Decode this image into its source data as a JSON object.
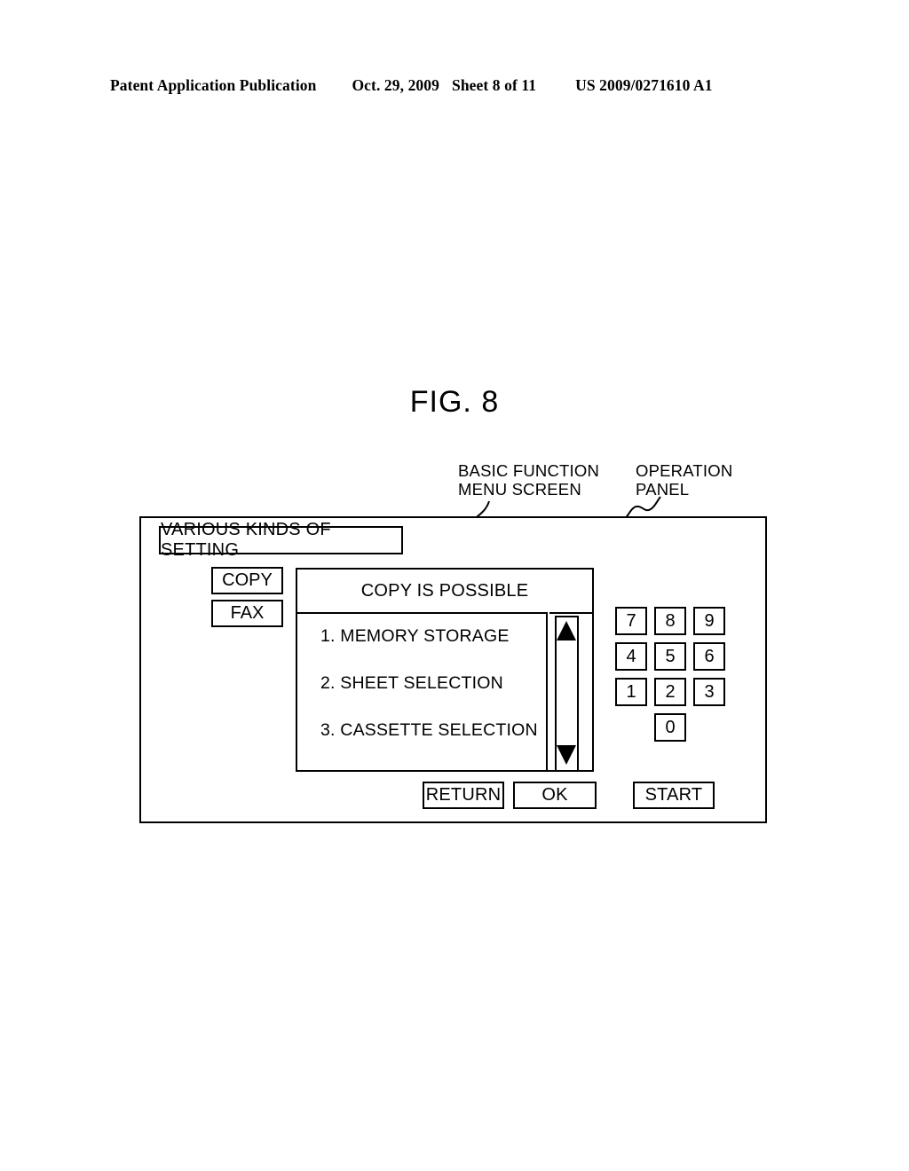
{
  "page_header": {
    "publication": "Patent Application Publication",
    "date": "Oct. 29, 2009",
    "sheet": "Sheet 8 of 11",
    "patent_number": "US 2009/0271610 A1"
  },
  "figure": {
    "title": "FIG. 8"
  },
  "callouts": {
    "basic_function_menu_screen": "BASIC FUNCTION\nMENU SCREEN",
    "operation_panel": "OPERATION\nPANEL"
  },
  "operation_panel": {
    "setting_box_label": "VARIOUS KINDS OF SETTING",
    "side_buttons": [
      {
        "label": "COPY"
      },
      {
        "label": "FAX"
      }
    ],
    "menu_screen": {
      "status_title": "COPY IS POSSIBLE",
      "items": [
        {
          "label": "1. MEMORY STORAGE"
        },
        {
          "label": "2. SHEET SELECTION"
        },
        {
          "label": "3. CASSETTE SELECTION"
        }
      ],
      "scrollbar": {
        "up_arrow": "scroll-up-arrow",
        "down_arrow": "scroll-down-arrow"
      }
    },
    "keypad": {
      "rows": [
        [
          "7",
          "8",
          "9"
        ],
        [
          "4",
          "5",
          "6"
        ],
        [
          "1",
          "2",
          "3"
        ]
      ],
      "zero": "0"
    },
    "action_buttons": {
      "return_label": "RETURN",
      "ok_label": "OK",
      "start_label": "START"
    }
  },
  "colors": {
    "ink": "#000000",
    "paper": "#ffffff"
  }
}
